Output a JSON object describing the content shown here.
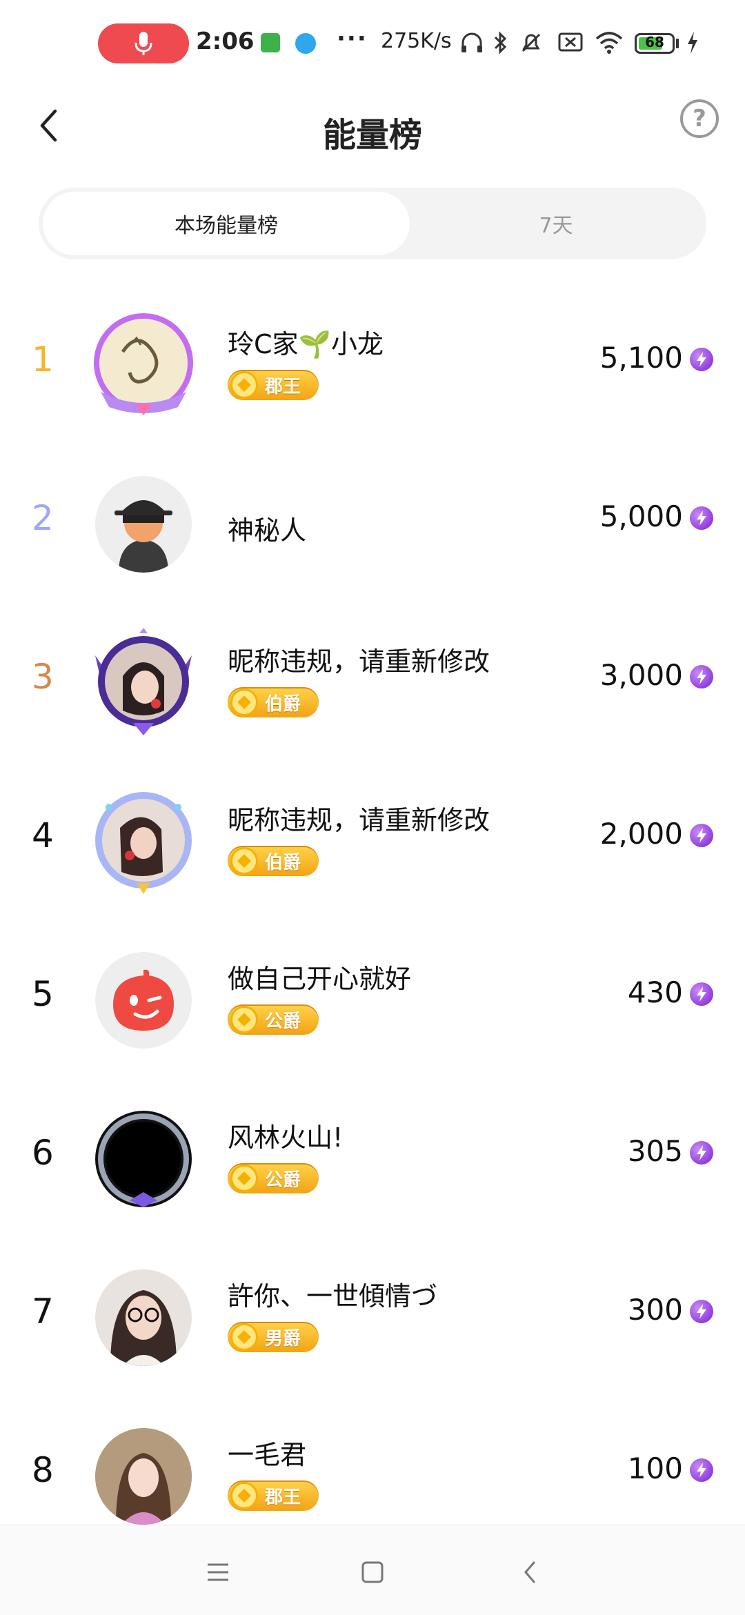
{
  "status_bar": {
    "time": "2:06",
    "dots": "···",
    "net_speed": "275K/s",
    "battery": "68",
    "icons": [
      "mic-icon",
      "app-icon-green",
      "app-icon-blue",
      "headphones-icon",
      "bluetooth-icon",
      "mute-bell-icon",
      "sim-off-icon",
      "wifi-icon",
      "battery-icon",
      "charging-icon"
    ]
  },
  "header": {
    "title": "能量榜",
    "help": "?"
  },
  "tabs": [
    {
      "label": "本场能量榜",
      "active": true
    },
    {
      "label": "7天",
      "active": false
    }
  ],
  "ranking": [
    {
      "rank": "1",
      "name": "玲C家🌱小龙",
      "badge": "郡王",
      "score": "5,100"
    },
    {
      "rank": "2",
      "name": "神秘人",
      "badge": "",
      "score": "5,000"
    },
    {
      "rank": "3",
      "name": "昵称违规，请重新修改",
      "badge": "伯爵",
      "score": "3,000"
    },
    {
      "rank": "4",
      "name": "昵称违规，请重新修改",
      "badge": "伯爵",
      "score": "2,000"
    },
    {
      "rank": "5",
      "name": "做自己开心就好",
      "badge": "公爵",
      "score": "430"
    },
    {
      "rank": "6",
      "name": "风林火山!",
      "badge": "公爵",
      "score": "305"
    },
    {
      "rank": "7",
      "name": "許你、一世傾情づ",
      "badge": "男爵",
      "score": "300"
    },
    {
      "rank": "8",
      "name": "一毛君",
      "badge": "郡王",
      "score": "100"
    }
  ],
  "colors": {
    "rank1": "#f7b52c",
    "rank2": "#9ea8f2",
    "rank3": "#d38b4d",
    "badge": "#f2a315",
    "energy": "#7a1fd6",
    "mic_pill": "#ef4a4f"
  }
}
